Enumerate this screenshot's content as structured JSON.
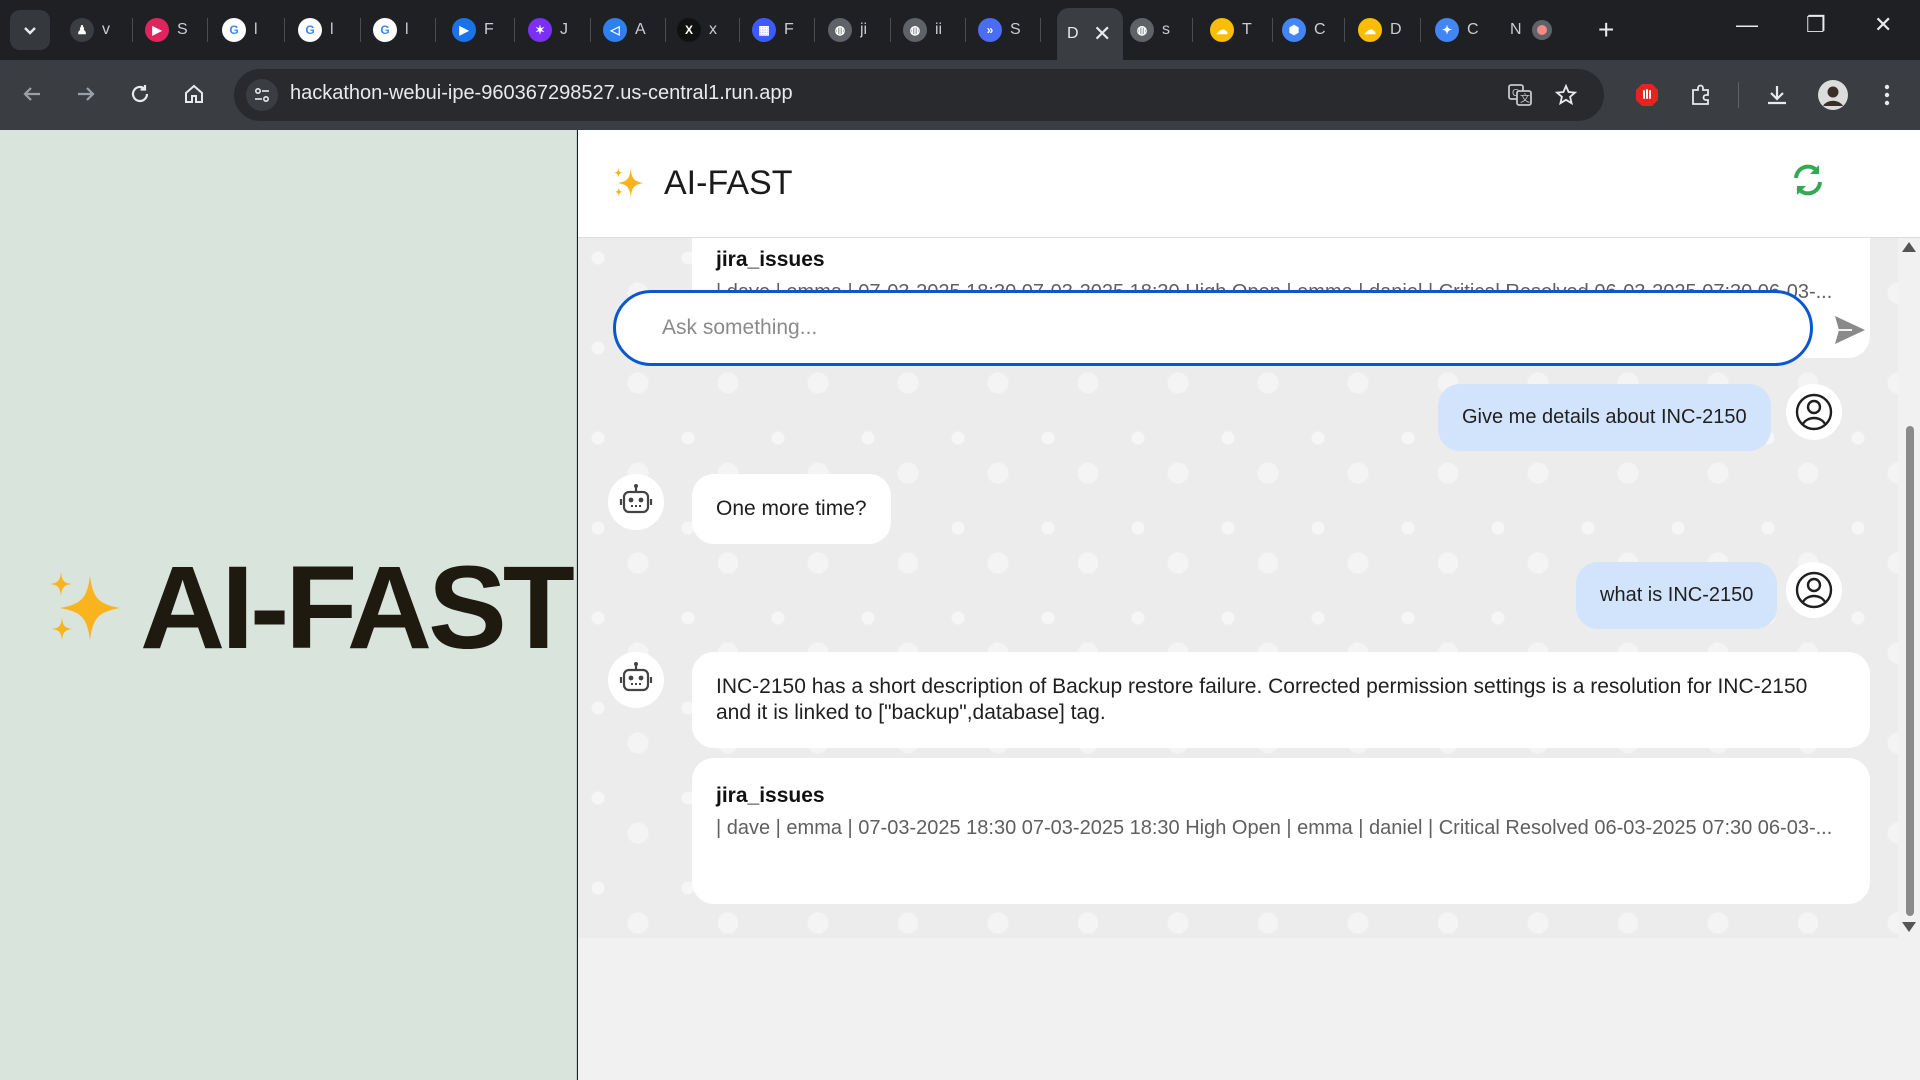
{
  "browser": {
    "tabs": [
      {
        "label": "v",
        "color": "#3a3d42",
        "glyph": "♟"
      },
      {
        "label": "S",
        "color": "#e0245e",
        "glyph": "▶"
      },
      {
        "label": "l",
        "color": "#ffffff",
        "glyph": "G"
      },
      {
        "label": "l",
        "color": "#ffffff",
        "glyph": "G"
      },
      {
        "label": "l",
        "color": "#ffffff",
        "glyph": "G"
      },
      {
        "label": "F",
        "color": "#1a73e8",
        "glyph": "▶"
      },
      {
        "label": "J",
        "color": "#7b2ff7",
        "glyph": "✶"
      },
      {
        "label": "A",
        "color": "#2f80ed",
        "glyph": "◁"
      },
      {
        "label": "x",
        "color": "#111111",
        "glyph": "X"
      },
      {
        "label": "F",
        "color": "#3d5afe",
        "glyph": "▦"
      },
      {
        "label": "ji",
        "color": "#5f6368",
        "glyph": "◍"
      },
      {
        "label": "ii",
        "color": "#5f6368",
        "glyph": "◍"
      },
      {
        "label": "S",
        "color": "#4a6cf7",
        "glyph": "»"
      },
      {
        "label": "s",
        "color": "#5f6368",
        "glyph": "◍"
      },
      {
        "label": "T",
        "color": "#fbbc04",
        "glyph": "☁"
      },
      {
        "label": "C",
        "color": "#4285f4",
        "glyph": "⬢"
      },
      {
        "label": "D",
        "color": "#fbbc04",
        "glyph": "☁"
      },
      {
        "label": "C",
        "color": "#4285f4",
        "glyph": "✦"
      }
    ],
    "active_tab_label": "D",
    "last_tab_label": "N",
    "url": "hackathon-webui-ipe-960367298527.us-central1.run.app"
  },
  "app": {
    "brand": "AI-FAST",
    "header_title": "AI-FAST",
    "accent_color": "#0b57d0",
    "refresh_color": "#34a853"
  },
  "messages": [
    {
      "role": "bot-source",
      "title": "jira_issues",
      "body": "| dave | emma | 07-03-2025 18:30 07-03-2025 18:30 High Open | emma | daniel | Critical Resolved 06-03-2025 07:30 06-03-..."
    },
    {
      "role": "user",
      "text": "Give me details about INC-2150"
    },
    {
      "role": "bot",
      "text": "One more time?"
    },
    {
      "role": "user",
      "text": "what is INC-2150"
    },
    {
      "role": "bot",
      "text": "INC-2150 has a short description of Backup restore failure. Corrected permission settings is a resolution for INC-2150 and it is linked to [\"backup\",database] tag."
    },
    {
      "role": "bot-source",
      "title": "jira_issues",
      "body": "| dave | emma | 07-03-2025 18:30 07-03-2025 18:30 High Open | emma | daniel | Critical Resolved 06-03-2025 07:30 06-03-..."
    }
  ],
  "composer": {
    "placeholder": "Ask something..."
  }
}
